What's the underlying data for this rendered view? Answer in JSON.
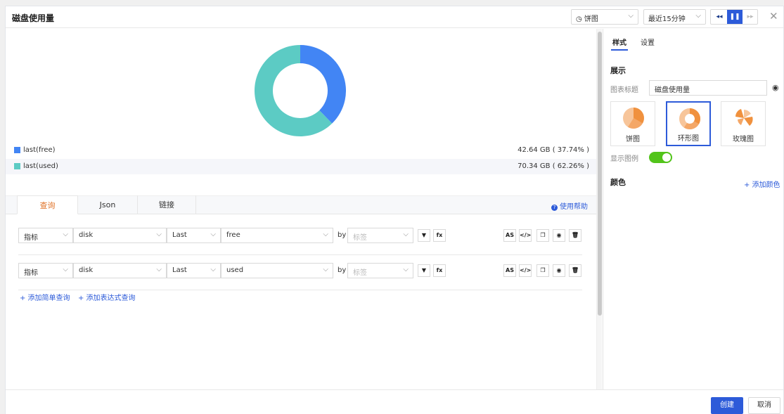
{
  "header": {
    "title": "磁盘使用量",
    "chart_type_select": "◷ 饼图",
    "time_range_select": "最近15分钟",
    "controls": [
      "◂◂",
      "❚❚",
      "▸▸"
    ],
    "close": "✕"
  },
  "chart_data": {
    "type": "pie",
    "subtype": "donut",
    "series": [
      {
        "name": "last(free)",
        "value": 42.64,
        "unit": "GB",
        "percent": 37.74,
        "color": "#4285f4",
        "display": "42.64 GB ( 37.74% )"
      },
      {
        "name": "last(used)",
        "value": 70.34,
        "unit": "GB",
        "percent": 62.26,
        "color": "#5ccbc4",
        "display": "70.34 GB ( 62.26% )"
      }
    ]
  },
  "query_tabs": [
    {
      "label": "查询",
      "active": true
    },
    {
      "label": "Json",
      "active": false
    },
    {
      "label": "链接",
      "active": false
    }
  ],
  "help_link": "使用帮助",
  "queries": [
    {
      "type": "指标",
      "measurement": "disk",
      "func": "Last",
      "field": "free",
      "by": "by",
      "tag_placeholder": "标签"
    },
    {
      "type": "指标",
      "measurement": "disk",
      "func": "Last",
      "field": "used",
      "by": "by",
      "tag_placeholder": "标签"
    }
  ],
  "query_icons": {
    "filter": "▼",
    "fx": "fx",
    "as": "AS",
    "code": "</>",
    "copy": "❐",
    "eye": "◉",
    "delete": "🗑"
  },
  "add_links": {
    "simple": "+ 添加简单查询",
    "expression": "+ 添加表达式查询"
  },
  "right_panel": {
    "tabs": [
      "样式",
      "设置"
    ],
    "section_display": "展示",
    "chart_title_label": "图表标题",
    "chart_title_value": "磁盘使用量",
    "chart_styles": [
      {
        "label": "饼图",
        "selected": false
      },
      {
        "label": "环形图",
        "selected": true
      },
      {
        "label": "玫瑰图",
        "selected": false
      }
    ],
    "show_legend_label": "显示图例",
    "show_legend": true,
    "section_color": "颜色",
    "add_color": "+ 添加颜色"
  },
  "footer": {
    "create": "创建",
    "cancel": "取消"
  },
  "colors": {
    "accent": "#2d5bd9",
    "orange": "#f0913e",
    "toggle_on": "#52c41a"
  }
}
